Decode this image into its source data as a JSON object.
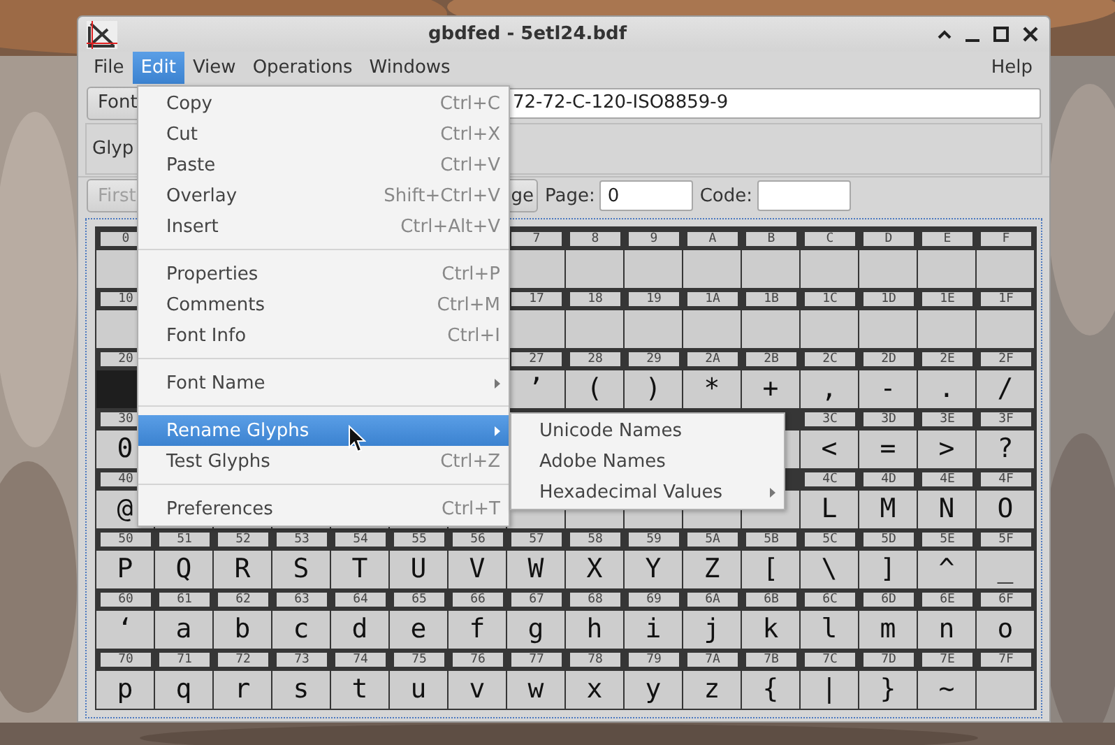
{
  "window": {
    "title": "gbdfed - 5etl24.bdf"
  },
  "menubar": [
    {
      "label": "File",
      "selected": false
    },
    {
      "label": "Edit",
      "selected": true
    },
    {
      "label": "View",
      "selected": false
    },
    {
      "label": "Operations",
      "selected": false
    },
    {
      "label": "Windows",
      "selected": false
    },
    {
      "label": "Help",
      "selected": false
    }
  ],
  "font_row": {
    "button": "Font",
    "value": "72-72-C-120-ISO8859-9"
  },
  "glyph_panel": {
    "label": "Glyp"
  },
  "toolbar": {
    "first_button": {
      "label": "First",
      "disabled": true
    },
    "page_button": {
      "label": "ge",
      "disabled": false
    },
    "page_label": "Page:",
    "page_value": "0",
    "code_label": "Code:"
  },
  "grid": {
    "rows": [
      {
        "cells": [
          {
            "code": "0",
            "selected": false
          },
          {},
          {},
          {},
          {},
          {},
          {},
          {
            "code": "7",
            "selected": false
          },
          {
            "code": "8",
            "selected": false
          },
          {
            "code": "9",
            "selected": false
          },
          {
            "code": "A",
            "selected": false
          },
          {
            "code": "B",
            "selected": false
          },
          {
            "code": "C",
            "selected": false
          },
          {
            "code": "D",
            "selected": false
          },
          {
            "code": "E",
            "selected": false
          },
          {
            "code": "F",
            "selected": false
          }
        ]
      },
      {
        "cells": [
          {
            "code": "10",
            "selected": false
          },
          {},
          {},
          {},
          {},
          {},
          {},
          {
            "code": "17",
            "selected": false
          },
          {
            "code": "18",
            "selected": false
          },
          {
            "code": "19",
            "selected": false
          },
          {
            "code": "1A",
            "selected": false
          },
          {
            "code": "1B",
            "selected": false
          },
          {
            "code": "1C",
            "selected": false
          },
          {
            "code": "1D",
            "selected": false
          },
          {
            "code": "1E",
            "selected": false
          },
          {
            "code": "1F",
            "selected": false
          }
        ]
      },
      {
        "cells": [
          {
            "code": "20",
            "selected": true
          },
          {},
          {},
          {},
          {},
          {},
          {},
          {
            "code": "27",
            "glyph": "’",
            "selected": false
          },
          {
            "code": "28",
            "glyph": "(",
            "selected": false
          },
          {
            "code": "29",
            "glyph": ")",
            "selected": false
          },
          {
            "code": "2A",
            "glyph": "*",
            "selected": false
          },
          {
            "code": "2B",
            "glyph": "+",
            "selected": false
          },
          {
            "code": "2C",
            "glyph": ",",
            "selected": false
          },
          {
            "code": "2D",
            "glyph": "-",
            "selected": false
          },
          {
            "code": "2E",
            "glyph": ".",
            "selected": false
          },
          {
            "code": "2F",
            "glyph": "/",
            "selected": false
          }
        ]
      },
      {
        "cells": [
          {
            "code": "30",
            "glyph": "0",
            "selected": false
          },
          {},
          {},
          {},
          {},
          {},
          {},
          {},
          {},
          {},
          {},
          {
            "selected": false
          },
          {
            "code": "3C",
            "glyph": "<",
            "selected": false
          },
          {
            "code": "3D",
            "glyph": "=",
            "selected": false
          },
          {
            "code": "3E",
            "glyph": ">",
            "selected": false
          },
          {
            "code": "3F",
            "glyph": "?",
            "selected": false
          }
        ]
      },
      {
        "cells": [
          {
            "code": "40",
            "glyph": "@",
            "selected": false
          },
          {},
          {},
          {},
          {},
          {},
          {},
          {
            "selected": false
          },
          {
            "selected": false
          },
          {
            "selected": false
          },
          {
            "selected": false
          },
          {
            "selected": false
          },
          {
            "code": "4C",
            "glyph": "L",
            "selected": false
          },
          {
            "code": "4D",
            "glyph": "M",
            "selected": false
          },
          {
            "code": "4E",
            "glyph": "N",
            "selected": false
          },
          {
            "code": "4F",
            "glyph": "O",
            "selected": false
          }
        ]
      },
      {
        "cells": [
          {
            "code": "50",
            "glyph": "P",
            "selected": false
          },
          {
            "code": "51",
            "glyph": "Q",
            "selected": false
          },
          {
            "code": "52",
            "glyph": "R",
            "selected": false
          },
          {
            "code": "53",
            "glyph": "S",
            "selected": false
          },
          {
            "code": "54",
            "glyph": "T",
            "selected": false
          },
          {
            "code": "55",
            "glyph": "U",
            "selected": false
          },
          {
            "code": "56",
            "glyph": "V",
            "selected": false
          },
          {
            "code": "57",
            "glyph": "W",
            "selected": false
          },
          {
            "code": "58",
            "glyph": "X",
            "selected": false
          },
          {
            "code": "59",
            "glyph": "Y",
            "selected": false
          },
          {
            "code": "5A",
            "glyph": "Z",
            "selected": false
          },
          {
            "code": "5B",
            "glyph": "[",
            "selected": false
          },
          {
            "code": "5C",
            "glyph": "\\",
            "selected": false
          },
          {
            "code": "5D",
            "glyph": "]",
            "selected": false
          },
          {
            "code": "5E",
            "glyph": "^",
            "selected": false
          },
          {
            "code": "5F",
            "glyph": "_",
            "selected": false
          }
        ]
      },
      {
        "cells": [
          {
            "code": "60",
            "glyph": "‘",
            "selected": false
          },
          {
            "code": "61",
            "glyph": "a",
            "selected": false
          },
          {
            "code": "62",
            "glyph": "b",
            "selected": false
          },
          {
            "code": "63",
            "glyph": "c",
            "selected": false
          },
          {
            "code": "64",
            "glyph": "d",
            "selected": false
          },
          {
            "code": "65",
            "glyph": "e",
            "selected": false
          },
          {
            "code": "66",
            "glyph": "f",
            "selected": false
          },
          {
            "code": "67",
            "glyph": "g",
            "selected": false
          },
          {
            "code": "68",
            "glyph": "h",
            "selected": false
          },
          {
            "code": "69",
            "glyph": "i",
            "selected": false
          },
          {
            "code": "6A",
            "glyph": "j",
            "selected": false
          },
          {
            "code": "6B",
            "glyph": "k",
            "selected": false
          },
          {
            "code": "6C",
            "glyph": "l",
            "selected": false
          },
          {
            "code": "6D",
            "glyph": "m",
            "selected": false
          },
          {
            "code": "6E",
            "glyph": "n",
            "selected": false
          },
          {
            "code": "6F",
            "glyph": "o",
            "selected": false
          }
        ]
      },
      {
        "cells": [
          {
            "code": "70",
            "glyph": "p",
            "selected": false
          },
          {
            "code": "71",
            "glyph": "q",
            "selected": false
          },
          {
            "code": "72",
            "glyph": "r",
            "selected": false
          },
          {
            "code": "73",
            "glyph": "s",
            "selected": false
          },
          {
            "code": "74",
            "glyph": "t",
            "selected": false
          },
          {
            "code": "75",
            "glyph": "u",
            "selected": false
          },
          {
            "code": "76",
            "glyph": "v",
            "selected": false
          },
          {
            "code": "77",
            "glyph": "w",
            "selected": false
          },
          {
            "code": "78",
            "glyph": "x",
            "selected": false
          },
          {
            "code": "79",
            "glyph": "y",
            "selected": false
          },
          {
            "code": "7A",
            "glyph": "z",
            "selected": false
          },
          {
            "code": "7B",
            "glyph": "{",
            "selected": false
          },
          {
            "code": "7C",
            "glyph": "|",
            "selected": false
          },
          {
            "code": "7D",
            "glyph": "}",
            "selected": false
          },
          {
            "code": "7E",
            "glyph": "~",
            "selected": false
          },
          {
            "code": "7F",
            "selected": false
          }
        ]
      }
    ]
  },
  "edit_menu": {
    "items": [
      {
        "kind": "item",
        "label": "Copy",
        "shortcut": "Ctrl+C",
        "selected": false
      },
      {
        "kind": "item",
        "label": "Cut",
        "shortcut": "Ctrl+X",
        "selected": false
      },
      {
        "kind": "item",
        "label": "Paste",
        "shortcut": "Ctrl+V",
        "selected": false
      },
      {
        "kind": "item",
        "label": "Overlay",
        "shortcut": "Shift+Ctrl+V",
        "selected": false
      },
      {
        "kind": "item",
        "label": "Insert",
        "shortcut": "Ctrl+Alt+V",
        "selected": false
      },
      {
        "kind": "separator"
      },
      {
        "kind": "item",
        "label": "Properties",
        "shortcut": "Ctrl+P",
        "selected": false
      },
      {
        "kind": "item",
        "label": "Comments",
        "shortcut": "Ctrl+M",
        "selected": false
      },
      {
        "kind": "item",
        "label": "Font Info",
        "shortcut": "Ctrl+I",
        "selected": false
      },
      {
        "kind": "separator"
      },
      {
        "kind": "submenu",
        "label": "Font Name",
        "selected": false
      },
      {
        "kind": "separator"
      },
      {
        "kind": "submenu",
        "label": "Rename Glyphs",
        "selected": true
      },
      {
        "kind": "item",
        "label": "Test Glyphs",
        "shortcut": "Ctrl+Z",
        "selected": false
      },
      {
        "kind": "separator"
      },
      {
        "kind": "item",
        "label": "Preferences",
        "shortcut": "Ctrl+T",
        "selected": false
      }
    ]
  },
  "rename_submenu": {
    "items": [
      {
        "kind": "item",
        "label": "Unicode Names",
        "selected": false
      },
      {
        "kind": "item",
        "label": "Adobe Names",
        "selected": false
      },
      {
        "kind": "submenu",
        "label": "Hexadecimal Values",
        "selected": false
      }
    ]
  }
}
